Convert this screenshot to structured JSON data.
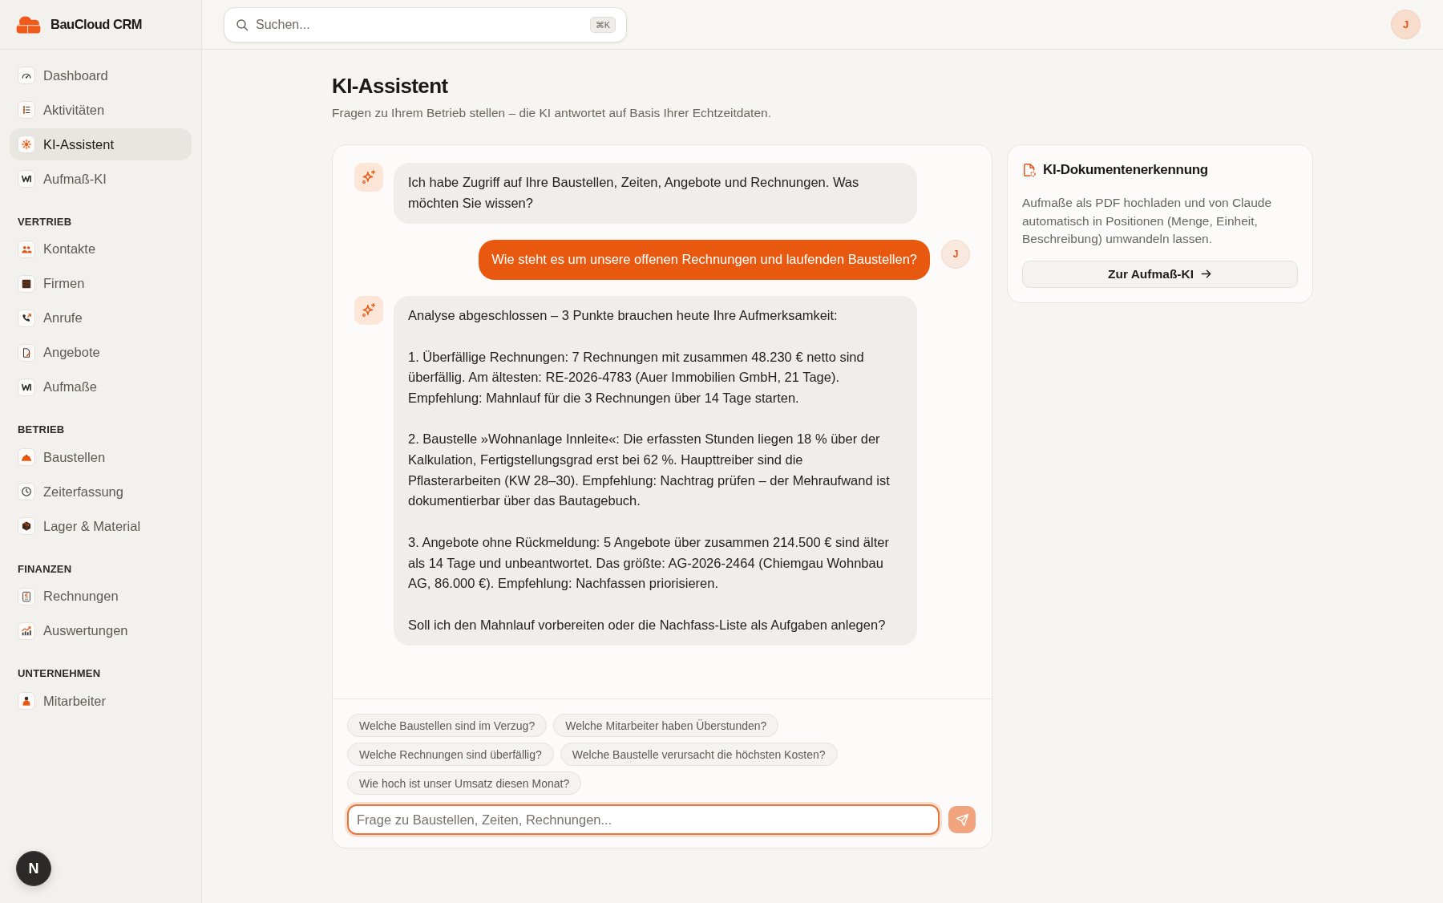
{
  "app": {
    "name": "BauCloud CRM"
  },
  "sidebar": {
    "groups": [
      {
        "items": [
          {
            "label": "Dashboard",
            "selected": false
          },
          {
            "label": "Aktivitäten",
            "selected": false
          },
          {
            "label": "KI-Assistent",
            "selected": true
          },
          {
            "label": "Aufmaß-KI",
            "selected": false
          }
        ]
      },
      {
        "title": "VERTRIEB",
        "items": [
          {
            "label": "Kontakte",
            "selected": false
          },
          {
            "label": "Firmen",
            "selected": false
          },
          {
            "label": "Anrufe",
            "selected": false
          },
          {
            "label": "Angebote",
            "selected": false
          },
          {
            "label": "Aufmaße",
            "selected": false
          }
        ]
      },
      {
        "title": "BETRIEB",
        "items": [
          {
            "label": "Baustellen",
            "selected": false
          },
          {
            "label": "Zeiterfassung",
            "selected": false
          },
          {
            "label": "Lager & Material",
            "selected": false
          }
        ]
      },
      {
        "title": "FINANZEN",
        "items": [
          {
            "label": "Rechnungen",
            "selected": false
          },
          {
            "label": "Auswertungen",
            "selected": false
          }
        ]
      },
      {
        "title": "UNTERNEHMEN",
        "items": [
          {
            "label": "Mitarbeiter",
            "selected": false
          }
        ]
      }
    ]
  },
  "dev_tools": {
    "label": "N"
  },
  "topbar": {
    "search": {
      "placeholder": "Suchen...",
      "shortcut": "⌘K"
    },
    "avatar": "J"
  },
  "page": {
    "title": "KI-Assistent",
    "subtitle": "Fragen zu Ihrem Betrieb stellen – die KI antwortet auf Basis Ihrer Echtzeitdaten."
  },
  "chat": {
    "messages": [
      {
        "kind": "assistant",
        "paragraphs": [
          "Ich habe Zugriff auf Ihre Baustellen, Zeiten, Angebote und Rechnungen. Was möchten Sie wissen?"
        ]
      },
      {
        "kind": "user",
        "avatar": "J",
        "paragraphs": [
          "Wie steht es um unsere offenen Rechnungen und laufenden Baustellen?"
        ]
      },
      {
        "kind": "assistant",
        "paragraphs": [
          "Analyse abgeschlossen – 3 Punkte brauchen heute Ihre Aufmerksamkeit:",
          "1. Überfällige Rechnungen: 7 Rechnungen mit zusammen 48.230 € netto sind überfällig. Am ältesten: RE-2026-4783 (Auer Immobilien GmbH, 21 Tage). Empfehlung: Mahnlauf für die 3 Rechnungen über 14 Tage starten.",
          "2. Baustelle »Wohnanlage Innleite«: Die erfassten Stunden liegen 18 % über der Kalkulation, Fertigstellungsgrad erst bei 62 %. Haupttreiber sind die Pflasterarbeiten (KW 28–30). Empfehlung: Nachtrag prüfen – der Mehraufwand ist dokumentierbar über das Bautagebuch.",
          "3. Angebote ohne Rückmeldung: 5 Angebote über zusammen 214.500 € sind älter als 14 Tage und unbeantwortet. Das größte: AG-2026-2464 (Chiemgau Wohnbau AG, 86.000 €). Empfehlung: Nachfassen priorisieren.",
          "Soll ich den Mahnlauf vorbereiten oder die Nachfass-Liste als Aufgaben anlegen?"
        ]
      }
    ],
    "suggestions": [
      "Welche Baustellen sind im Verzug?",
      "Welche Mitarbeiter haben Überstunden?",
      "Welche Rechnungen sind überfällig?",
      "Welche Baustelle verursacht die höchsten Kosten?",
      "Wie hoch ist unser Umsatz diesen Monat?"
    ],
    "input": {
      "placeholder": "Frage zu Baustellen, Zeiten, Rechnungen..."
    },
    "send": {
      "disabled": true
    }
  },
  "side_card": {
    "title": "KI-Dokumentenerkennung",
    "text": "Aufmaße als PDF hochladen und von Claude automatisch in Positionen (Menge, Einheit, Beschreibung) umwandeln lassen.",
    "button": "Zur Aufmaß-KI"
  }
}
